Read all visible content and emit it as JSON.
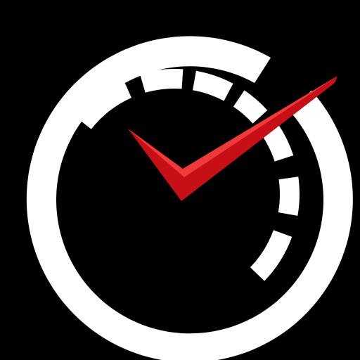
{
  "app_icon": {
    "name": "gauge-checkmark-icon",
    "colors": {
      "background": "#000000",
      "ring": "#FFFFFF",
      "segments": "#FFFFFF",
      "checkmark": "#D3131C",
      "checkmark_highlight": "#F03A3A"
    }
  }
}
